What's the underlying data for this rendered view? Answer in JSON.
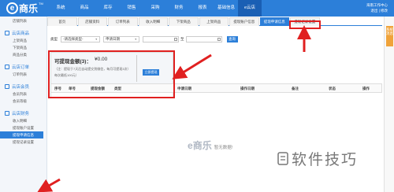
{
  "brand": {
    "logo_letter": "e",
    "name": "商乐",
    "tm": "TM"
  },
  "topnav": {
    "items": [
      "系统",
      "商品",
      "库存",
      "销售",
      "采购",
      "财务",
      "报表",
      "基础信息",
      "e云店"
    ],
    "active_index": 8
  },
  "user": {
    "line1": "海南工作中心",
    "line2": "退出 | 修改"
  },
  "sidebar": {
    "top_items": [
      "店铺列表"
    ],
    "groups": [
      {
        "title": "云店商品",
        "items": [
          "上架商品",
          "下架商品",
          "商品分类"
        ]
      },
      {
        "title": "云店订单",
        "items": [
          "订单列表"
        ]
      },
      {
        "title": "云店会员",
        "items": [
          "会员列表",
          "会员等级"
        ]
      },
      {
        "title": "云店财务",
        "items": [
          "收入明细",
          "提现账户设置",
          "提现申请信息",
          "提现记录设置"
        ]
      }
    ],
    "active_item": "提现申请信息"
  },
  "tabs": {
    "items": [
      "首页",
      "店铺资料",
      "订单列表",
      "收入明细",
      "下架商品",
      "上架商品",
      "提现账户信息",
      "提现申请信息",
      "提现记录设置"
    ],
    "active_index": 7
  },
  "filters": {
    "type_label": "类型",
    "type_value": "-请选择类型-",
    "date_type_value": "申请日期",
    "range_sep": "至",
    "query_label": "查询"
  },
  "withdraw": {
    "title": "可提现金额(3)：",
    "amount": "¥0.00",
    "note1": "（注：提现于7天后自动提交到微信，每月可提现3次）",
    "note2": "每次最低100元）",
    "apply_label": "立即提现"
  },
  "table": {
    "headers": [
      "序号",
      "单号",
      "提现金额",
      "类型",
      "申请日期",
      "操作日期",
      "备注",
      "状态",
      "操作"
    ]
  },
  "empty": {
    "logo_letter": "e",
    "logo_name": "商乐",
    "text": "暂无数据!"
  },
  "right_rail": {
    "label": "系统消息"
  },
  "watermark": {
    "text": "软件技巧"
  },
  "colors": {
    "primary": "#2c7fd9",
    "highlight": "#e02020",
    "accent": "#f0a33a"
  }
}
